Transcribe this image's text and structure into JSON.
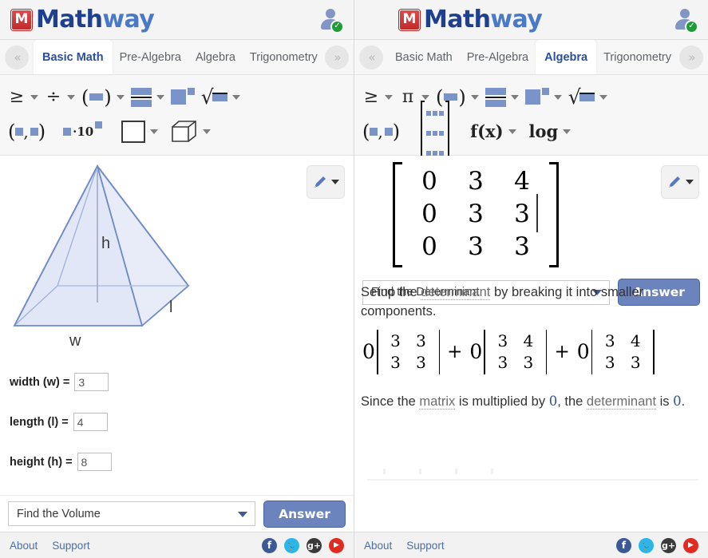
{
  "brand": {
    "name": "Mathway",
    "mark_glyph": "M",
    "name_part1": "Math",
    "name_part2": "way"
  },
  "header": {
    "avatar_icon": "user-avatar-icon",
    "verified_icon": "green-check-badge"
  },
  "left_pane": {
    "tabs": {
      "prev_label": "«",
      "next_label": "»",
      "items": [
        {
          "label": "Basic Math",
          "active": true
        },
        {
          "label": "Pre-Algebra",
          "active": false
        },
        {
          "label": "Algebra",
          "active": false
        },
        {
          "label": "Trigonometry",
          "active": false
        }
      ]
    },
    "toolbar": {
      "row1": [
        {
          "glyph": "≥",
          "name": "inequality-tool",
          "caret": true
        },
        {
          "glyph": "÷",
          "name": "divide-tool",
          "caret": true
        },
        {
          "glyph": "(■)",
          "name": "parentheses-tool",
          "caret": true
        },
        {
          "glyph": "fraction",
          "name": "fraction-tool",
          "caret": true
        },
        {
          "glyph": "exponent",
          "name": "exponent-tool",
          "caret": false
        },
        {
          "glyph": "√",
          "name": "radical-tool",
          "caret": true
        }
      ],
      "row2": [
        {
          "glyph": "(■,■)",
          "name": "coordinate-pair-tool",
          "caret": false
        },
        {
          "glyph": "■·10■",
          "name": "scientific-notation-tool",
          "caret": false
        },
        {
          "glyph": "square",
          "name": "square-shape-tool",
          "caret": true
        },
        {
          "glyph": "cube",
          "name": "cube-shape-tool",
          "caret": true
        }
      ]
    },
    "pencil_button": {
      "icon": "pencil-icon",
      "caret": true
    },
    "diagram": {
      "type": "rectangular-pyramid",
      "labels": {
        "height": "h",
        "length": "l",
        "width": "w"
      },
      "fill": "#e6eaf7",
      "stroke": "#7e96cb"
    },
    "fields": [
      {
        "label": "width (w) =",
        "value": "3",
        "name": "width-input"
      },
      {
        "label": "length (l) =",
        "value": "4",
        "name": "length-input"
      },
      {
        "label": "height (h) =",
        "value": "8",
        "name": "height-input"
      }
    ],
    "action": {
      "selected_option": "Find the Volume",
      "answer_label": "Answer"
    }
  },
  "right_pane": {
    "tabs": {
      "prev_label": "«",
      "next_label": "»",
      "items": [
        {
          "label": "Basic Math",
          "active": false
        },
        {
          "label": "Pre-Algebra",
          "active": false
        },
        {
          "label": "Algebra",
          "active": true
        },
        {
          "label": "Trigonometry",
          "active": false
        }
      ]
    },
    "toolbar": {
      "row1": [
        {
          "glyph": "≥",
          "name": "inequality-tool",
          "caret": true
        },
        {
          "glyph": "π",
          "name": "pi-tool",
          "caret": true
        },
        {
          "glyph": "(■)",
          "name": "parentheses-tool",
          "caret": true
        },
        {
          "glyph": "fraction",
          "name": "fraction-tool",
          "caret": true
        },
        {
          "glyph": "exponent",
          "name": "exponent-tool",
          "caret": true
        },
        {
          "glyph": "√",
          "name": "radical-tool",
          "caret": true
        }
      ],
      "row2": [
        {
          "glyph": "(■,■)",
          "name": "coordinate-pair-tool",
          "caret": false
        },
        {
          "glyph": "matrix",
          "name": "matrix-tool",
          "caret": false
        },
        {
          "glyph": "f(x)",
          "name": "function-tool",
          "caret": true
        },
        {
          "glyph": "log",
          "name": "logarithm-tool",
          "caret": true
        }
      ]
    },
    "pencil_button": {
      "icon": "pencil-icon",
      "caret": true
    },
    "matrix": {
      "rows": [
        [
          "0",
          "3",
          "4"
        ],
        [
          "0",
          "3",
          "3"
        ],
        [
          "0",
          "3",
          "3"
        ]
      ]
    },
    "action": {
      "selected_option": "Find the Determinant",
      "answer_label": "Answer"
    },
    "solution": {
      "step1_a": "Setup the ",
      "step1_term": "determinant",
      "step1_b": " by breaking it into smaller components.",
      "expansion": [
        {
          "coefficient": "0",
          "minor": [
            [
              "3",
              "3"
            ],
            [
              "3",
              "3"
            ]
          ]
        },
        {
          "coefficient": "0",
          "minor": [
            [
              "3",
              "4"
            ],
            [
              "3",
              "3"
            ]
          ]
        },
        {
          "coefficient": "0",
          "minor": [
            [
              "3",
              "4"
            ],
            [
              "3",
              "3"
            ]
          ]
        }
      ],
      "plus": "+",
      "step2_a": "Since the ",
      "step2_term1": "matrix",
      "step2_b": " is multiplied by ",
      "step2_num1": "0",
      "step2_c": ", the ",
      "step2_term2": "determinant",
      "step2_d": " is ",
      "step2_num2": "0",
      "step2_e": "."
    }
  },
  "footer": {
    "about_label": "About",
    "support_label": "Support",
    "social": [
      {
        "name": "facebook-icon",
        "glyph": "f",
        "color": "#3b5998"
      },
      {
        "name": "twitter-icon",
        "glyph": "✉",
        "color": "#29b6e8"
      },
      {
        "name": "googleplus-icon",
        "glyph": "g+",
        "color": "#3a3a3a"
      },
      {
        "name": "youtube-icon",
        "glyph": "▶",
        "color": "#e02b20"
      }
    ]
  }
}
